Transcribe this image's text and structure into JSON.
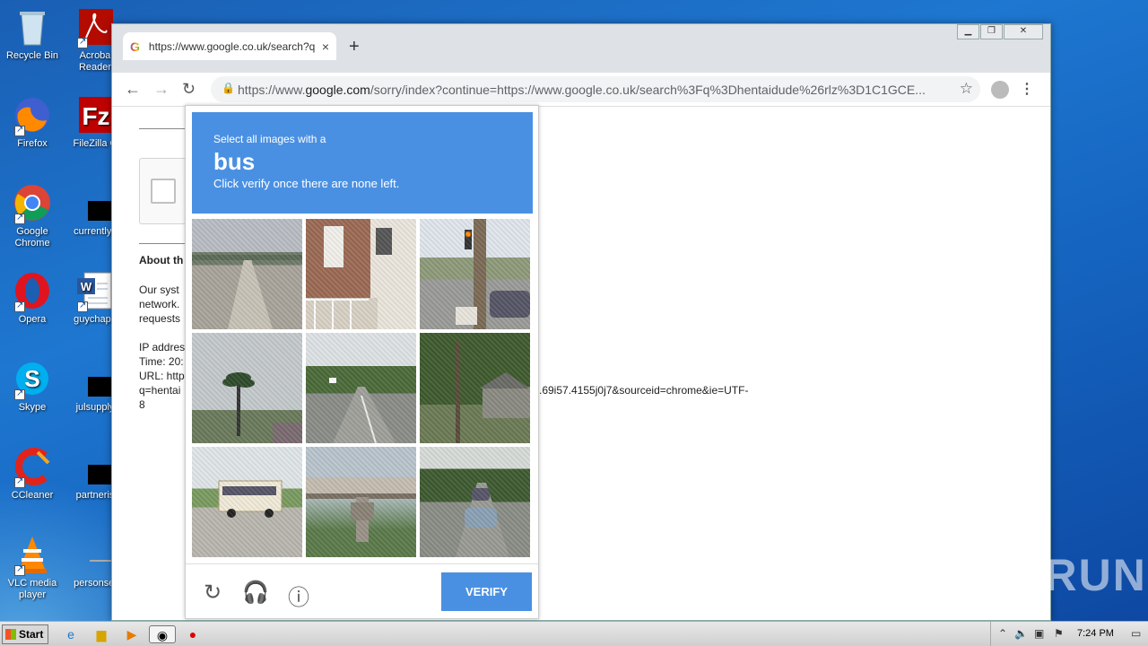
{
  "desktop": {
    "icons": [
      {
        "label": "Recycle Bin",
        "icon": "recycle-bin-icon"
      },
      {
        "label": "Acroba Reader",
        "icon": "acrobat-icon"
      },
      {
        "label": "Firefox",
        "icon": "firefox-icon"
      },
      {
        "label": "FileZilla C",
        "icon": "filezilla-icon"
      },
      {
        "label": "Google Chrome",
        "icon": "chrome-icon"
      },
      {
        "label": "currentlys",
        "icon": "redacted-icon"
      },
      {
        "label": "Opera",
        "icon": "opera-icon"
      },
      {
        "label": "guychapb",
        "icon": "word-doc-icon"
      },
      {
        "label": "Skype",
        "icon": "skype-icon"
      },
      {
        "label": "julsupply",
        "icon": "redacted-icon"
      },
      {
        "label": "CCleaner",
        "icon": "ccleaner-icon"
      },
      {
        "label": "partneris",
        "icon": "redacted-icon"
      },
      {
        "label": "VLC media player",
        "icon": "vlc-icon"
      },
      {
        "label": "personsel",
        "icon": "redacted-icon"
      }
    ]
  },
  "browser": {
    "tab_title": "https://www.google.co.uk/search?q",
    "tab_close": "×",
    "new_tab": "+",
    "url_host_prefix": "https://www.",
    "url_host": "google.com",
    "url_path": "/sorry/index?continue=https://www.google.co.uk/search%3Fq%3Dhentaidude%26rlz%3D1C1GCE..."
  },
  "page": {
    "about_heading": "About th",
    "para1": [
      "Our syst",
      "network.",
      "requests"
    ],
    "para2": [
      "IP addres",
      "Time: 20:",
      "URL: http",
      "q=hentai",
      "8"
    ],
    "url_tail": ".69i57.4155j0j7&sourceid=chrome&ie=UTF-"
  },
  "captcha": {
    "instruction_small": "Select all images with a",
    "target": "bus",
    "instruction_hint": "Click verify once there are none left.",
    "verify_label": "VERIFY",
    "tiles": [
      {
        "scene": "road-bridge"
      },
      {
        "scene": "brick-houses"
      },
      {
        "scene": "traffic-light-street"
      },
      {
        "scene": "palm-tree-sky"
      },
      {
        "scene": "highway-trees"
      },
      {
        "scene": "tree-building"
      },
      {
        "scene": "bus-parking-lot"
      },
      {
        "scene": "overpass"
      },
      {
        "scene": "road-cars"
      }
    ]
  },
  "watermark": "ANY RUN",
  "taskbar": {
    "start_label": "Start",
    "time": "7:24 PM"
  }
}
